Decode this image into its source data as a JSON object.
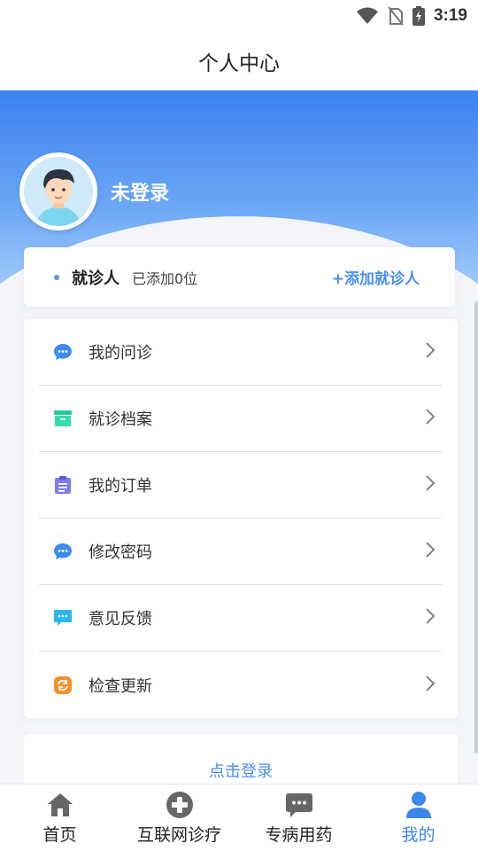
{
  "status_bar": {
    "time": "3:19"
  },
  "header": {
    "title": "个人中心"
  },
  "profile": {
    "login_status": "未登录"
  },
  "patient_card": {
    "label": "就诊人",
    "count": "已添加0位",
    "add_label": "+添加就诊人"
  },
  "menu": {
    "items": [
      {
        "label": "我的问诊",
        "icon": "chat-bubble-icon",
        "color": "#3d8af0"
      },
      {
        "label": "就诊档案",
        "icon": "archive-box-icon",
        "color": "#2dd4a4"
      },
      {
        "label": "我的订单",
        "icon": "clipboard-icon",
        "color": "#7b7cf0"
      },
      {
        "label": "修改密码",
        "icon": "chat-bubble-icon",
        "color": "#3d8af0"
      },
      {
        "label": "意见反馈",
        "icon": "feedback-message-icon",
        "color": "#2bb6f0"
      },
      {
        "label": "检查更新",
        "icon": "refresh-icon",
        "color": "#f0912d"
      }
    ]
  },
  "login_link": "点击登录",
  "tabs": [
    {
      "label": "首页",
      "icon": "home-icon",
      "active": false
    },
    {
      "label": "互联网诊疗",
      "icon": "medical-cross-icon",
      "active": false
    },
    {
      "label": "专病用药",
      "icon": "message-icon",
      "active": false
    },
    {
      "label": "我的",
      "icon": "person-icon",
      "active": true
    }
  ],
  "colors": {
    "accent": "#3b87ee",
    "hero_top": "#3b82ef",
    "hero_bottom": "#a7cdfa"
  }
}
